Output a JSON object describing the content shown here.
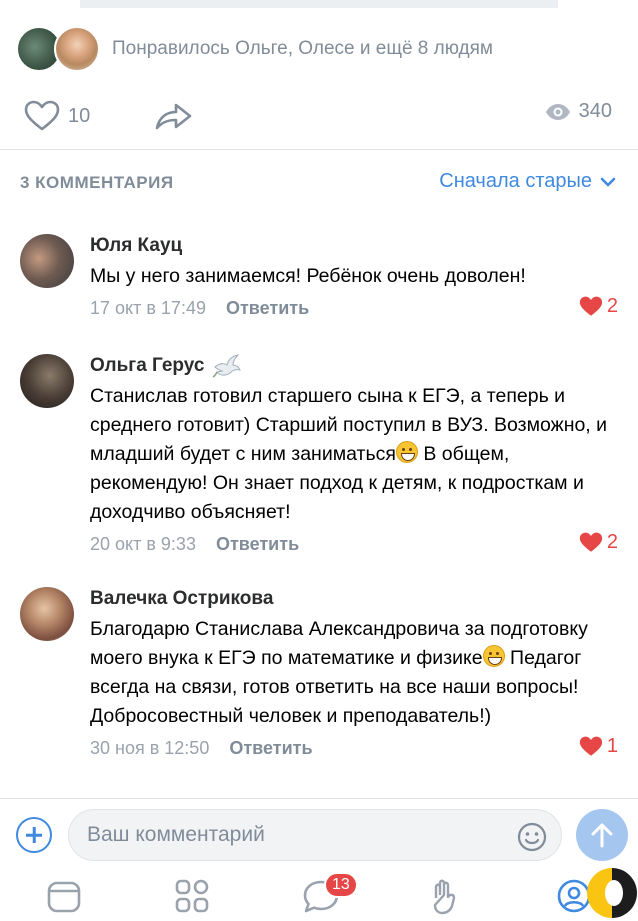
{
  "post": {
    "liked_by_text": "Понравилось Ольге, Олесе и ещё 8 людям",
    "likes_count": "10",
    "views_count": "340"
  },
  "comments_section": {
    "count_label": "3 КОММЕНТАРИЯ",
    "sort_label": "Сначала старые"
  },
  "comments": [
    {
      "author": "Юля Кауц",
      "text": "Мы у него занимаемся! Ребёнок очень доволен!",
      "date": "17 окт в 17:49",
      "reply_label": "Ответить",
      "likes": "2"
    },
    {
      "author": "Ольга Герус",
      "text": "Станислав готовил старшего сына к ЕГЭ, а теперь и среднего готовит) Старший поступил в ВУЗ. Возможно, и младший будет с ним заниматься",
      "text2": "В общем, рекомендую! Он знает подход к детям, к подросткам и доходчиво объясняет!",
      "date": "20 окт в 9:33",
      "reply_label": "Ответить",
      "likes": "2"
    },
    {
      "author": "Валечка Острикова",
      "text": "Благодарю Станислава Александровича за подготовку моего внука к ЕГЭ по математике и физике",
      "text2": " Педагог всегда на связи, готов ответить на все наши вопросы! Добросовестный человек и преподаватель!)",
      "date": "30 ноя в 12:50",
      "reply_label": "Ответить",
      "likes": "1"
    }
  ],
  "composer": {
    "placeholder": "Ваш комментарий"
  },
  "tabbar": {
    "messages_badge": "13"
  },
  "colors": {
    "accent": "#3f8ae0",
    "secondary_text": "#818c99",
    "like_red": "#e64646",
    "send_button": "#a4c6ef"
  },
  "icons": [
    "heart-outline-icon",
    "share-icon",
    "eye-icon",
    "chevron-down-icon",
    "heart-filled-icon",
    "dove-icon",
    "smile-emoji-icon",
    "plus-icon",
    "emoji-picker-icon",
    "send-arrow-icon",
    "news-tab-icon",
    "services-tab-icon",
    "messages-tab-icon",
    "clips-tab-icon",
    "profile-tab-icon"
  ]
}
